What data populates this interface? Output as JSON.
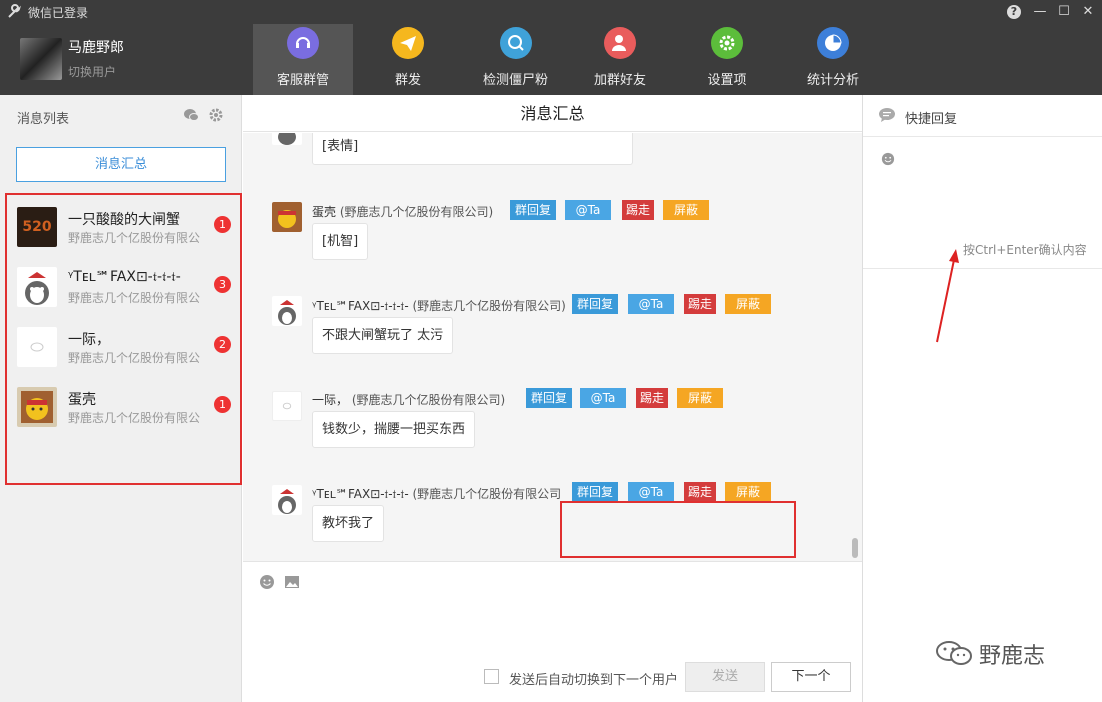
{
  "titlebar": {
    "title": "微信已登录",
    "help": "?",
    "minimize": "—",
    "maximize": "☐",
    "close": "✕"
  },
  "account": {
    "name": "马鹿野郎",
    "switch_label": "切换用户"
  },
  "nav": {
    "tabs": [
      {
        "label": "客服群管",
        "color": "#7a6de0"
      },
      {
        "label": "群发",
        "color": "#f5b71e"
      },
      {
        "label": "检测僵尸粉",
        "color": "#3fa2d9"
      },
      {
        "label": "加群好友",
        "color": "#e95c5c"
      },
      {
        "label": "设置项",
        "color": "#5cbd3b"
      },
      {
        "label": "统计分析",
        "color": "#3d7fd9"
      }
    ]
  },
  "sidebar": {
    "title": "消息列表",
    "summary_button": "消息汇总",
    "contacts": [
      {
        "name": "一只酸酸的大闸蟹",
        "sub": "野鹿志几个亿股份有限公",
        "badge": "1",
        "avatar_text": "520"
      },
      {
        "name": "ᵞTᴇʟ℠FAX⊡-𝔱-𝔱-𝔱-",
        "sub": "野鹿志几个亿股份有限公",
        "badge": "3"
      },
      {
        "name": "一际，",
        "sub": "野鹿志几个亿股份有限公",
        "badge": "2"
      },
      {
        "name": "蛋壳",
        "sub": "野鹿志几个亿股份有限公",
        "badge": "1"
      }
    ]
  },
  "main": {
    "title": "消息汇总",
    "actions": {
      "reply": "群回复",
      "at": "@Ta",
      "kick": "踢走",
      "block": "屏蔽"
    },
    "first_bubble": "[表情]",
    "messages": [
      {
        "sender": "蛋壳",
        "group": "(野鹿志几个亿股份有限公司)",
        "text": "[机智]"
      },
      {
        "sender": "ᵞTᴇʟ℠FAX⊡-𝔱-𝔱-𝔱-",
        "group": "(野鹿志几个亿股份有限公司)",
        "text": "不跟大闸蟹玩了    太污"
      },
      {
        "sender": "一际，",
        "group": "(野鹿志几个亿股份有限公司)",
        "text": "钱数少，揣腰一把买东西"
      },
      {
        "sender": "ᵞTᴇʟ℠FAX⊡-𝔱-𝔱-𝔱-",
        "group": "(野鹿志几个亿股份有限公司",
        "text": "教坏我了"
      }
    ],
    "auto_switch_label": "发送后自动切换到下一个用户",
    "send_button": "发送",
    "next_button": "下一个"
  },
  "quick_reply": {
    "title": "快捷回复",
    "hint": "按Ctrl+Enter确认内容"
  },
  "watermark": "野鹿志"
}
